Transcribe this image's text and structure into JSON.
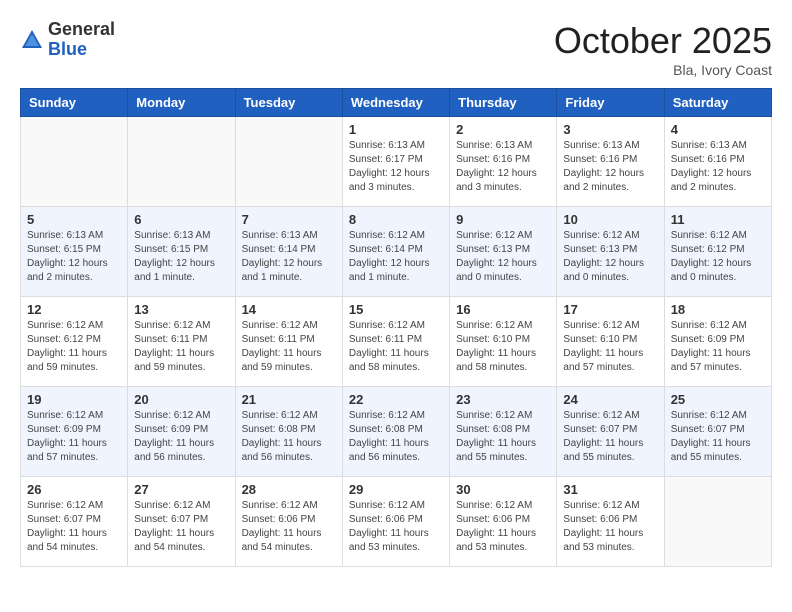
{
  "logo": {
    "general": "General",
    "blue": "Blue"
  },
  "header": {
    "month": "October 2025",
    "location": "Bla, Ivory Coast"
  },
  "weekdays": [
    "Sunday",
    "Monday",
    "Tuesday",
    "Wednesday",
    "Thursday",
    "Friday",
    "Saturday"
  ],
  "weeks": [
    [
      {
        "day": "",
        "info": ""
      },
      {
        "day": "",
        "info": ""
      },
      {
        "day": "",
        "info": ""
      },
      {
        "day": "1",
        "info": "Sunrise: 6:13 AM\nSunset: 6:17 PM\nDaylight: 12 hours\nand 3 minutes."
      },
      {
        "day": "2",
        "info": "Sunrise: 6:13 AM\nSunset: 6:16 PM\nDaylight: 12 hours\nand 3 minutes."
      },
      {
        "day": "3",
        "info": "Sunrise: 6:13 AM\nSunset: 6:16 PM\nDaylight: 12 hours\nand 2 minutes."
      },
      {
        "day": "4",
        "info": "Sunrise: 6:13 AM\nSunset: 6:16 PM\nDaylight: 12 hours\nand 2 minutes."
      }
    ],
    [
      {
        "day": "5",
        "info": "Sunrise: 6:13 AM\nSunset: 6:15 PM\nDaylight: 12 hours\nand 2 minutes."
      },
      {
        "day": "6",
        "info": "Sunrise: 6:13 AM\nSunset: 6:15 PM\nDaylight: 12 hours\nand 1 minute."
      },
      {
        "day": "7",
        "info": "Sunrise: 6:13 AM\nSunset: 6:14 PM\nDaylight: 12 hours\nand 1 minute."
      },
      {
        "day": "8",
        "info": "Sunrise: 6:12 AM\nSunset: 6:14 PM\nDaylight: 12 hours\nand 1 minute."
      },
      {
        "day": "9",
        "info": "Sunrise: 6:12 AM\nSunset: 6:13 PM\nDaylight: 12 hours\nand 0 minutes."
      },
      {
        "day": "10",
        "info": "Sunrise: 6:12 AM\nSunset: 6:13 PM\nDaylight: 12 hours\nand 0 minutes."
      },
      {
        "day": "11",
        "info": "Sunrise: 6:12 AM\nSunset: 6:12 PM\nDaylight: 12 hours\nand 0 minutes."
      }
    ],
    [
      {
        "day": "12",
        "info": "Sunrise: 6:12 AM\nSunset: 6:12 PM\nDaylight: 11 hours\nand 59 minutes."
      },
      {
        "day": "13",
        "info": "Sunrise: 6:12 AM\nSunset: 6:11 PM\nDaylight: 11 hours\nand 59 minutes."
      },
      {
        "day": "14",
        "info": "Sunrise: 6:12 AM\nSunset: 6:11 PM\nDaylight: 11 hours\nand 59 minutes."
      },
      {
        "day": "15",
        "info": "Sunrise: 6:12 AM\nSunset: 6:11 PM\nDaylight: 11 hours\nand 58 minutes."
      },
      {
        "day": "16",
        "info": "Sunrise: 6:12 AM\nSunset: 6:10 PM\nDaylight: 11 hours\nand 58 minutes."
      },
      {
        "day": "17",
        "info": "Sunrise: 6:12 AM\nSunset: 6:10 PM\nDaylight: 11 hours\nand 57 minutes."
      },
      {
        "day": "18",
        "info": "Sunrise: 6:12 AM\nSunset: 6:09 PM\nDaylight: 11 hours\nand 57 minutes."
      }
    ],
    [
      {
        "day": "19",
        "info": "Sunrise: 6:12 AM\nSunset: 6:09 PM\nDaylight: 11 hours\nand 57 minutes."
      },
      {
        "day": "20",
        "info": "Sunrise: 6:12 AM\nSunset: 6:09 PM\nDaylight: 11 hours\nand 56 minutes."
      },
      {
        "day": "21",
        "info": "Sunrise: 6:12 AM\nSunset: 6:08 PM\nDaylight: 11 hours\nand 56 minutes."
      },
      {
        "day": "22",
        "info": "Sunrise: 6:12 AM\nSunset: 6:08 PM\nDaylight: 11 hours\nand 56 minutes."
      },
      {
        "day": "23",
        "info": "Sunrise: 6:12 AM\nSunset: 6:08 PM\nDaylight: 11 hours\nand 55 minutes."
      },
      {
        "day": "24",
        "info": "Sunrise: 6:12 AM\nSunset: 6:07 PM\nDaylight: 11 hours\nand 55 minutes."
      },
      {
        "day": "25",
        "info": "Sunrise: 6:12 AM\nSunset: 6:07 PM\nDaylight: 11 hours\nand 55 minutes."
      }
    ],
    [
      {
        "day": "26",
        "info": "Sunrise: 6:12 AM\nSunset: 6:07 PM\nDaylight: 11 hours\nand 54 minutes."
      },
      {
        "day": "27",
        "info": "Sunrise: 6:12 AM\nSunset: 6:07 PM\nDaylight: 11 hours\nand 54 minutes."
      },
      {
        "day": "28",
        "info": "Sunrise: 6:12 AM\nSunset: 6:06 PM\nDaylight: 11 hours\nand 54 minutes."
      },
      {
        "day": "29",
        "info": "Sunrise: 6:12 AM\nSunset: 6:06 PM\nDaylight: 11 hours\nand 53 minutes."
      },
      {
        "day": "30",
        "info": "Sunrise: 6:12 AM\nSunset: 6:06 PM\nDaylight: 11 hours\nand 53 minutes."
      },
      {
        "day": "31",
        "info": "Sunrise: 6:12 AM\nSunset: 6:06 PM\nDaylight: 11 hours\nand 53 minutes."
      },
      {
        "day": "",
        "info": ""
      }
    ]
  ]
}
